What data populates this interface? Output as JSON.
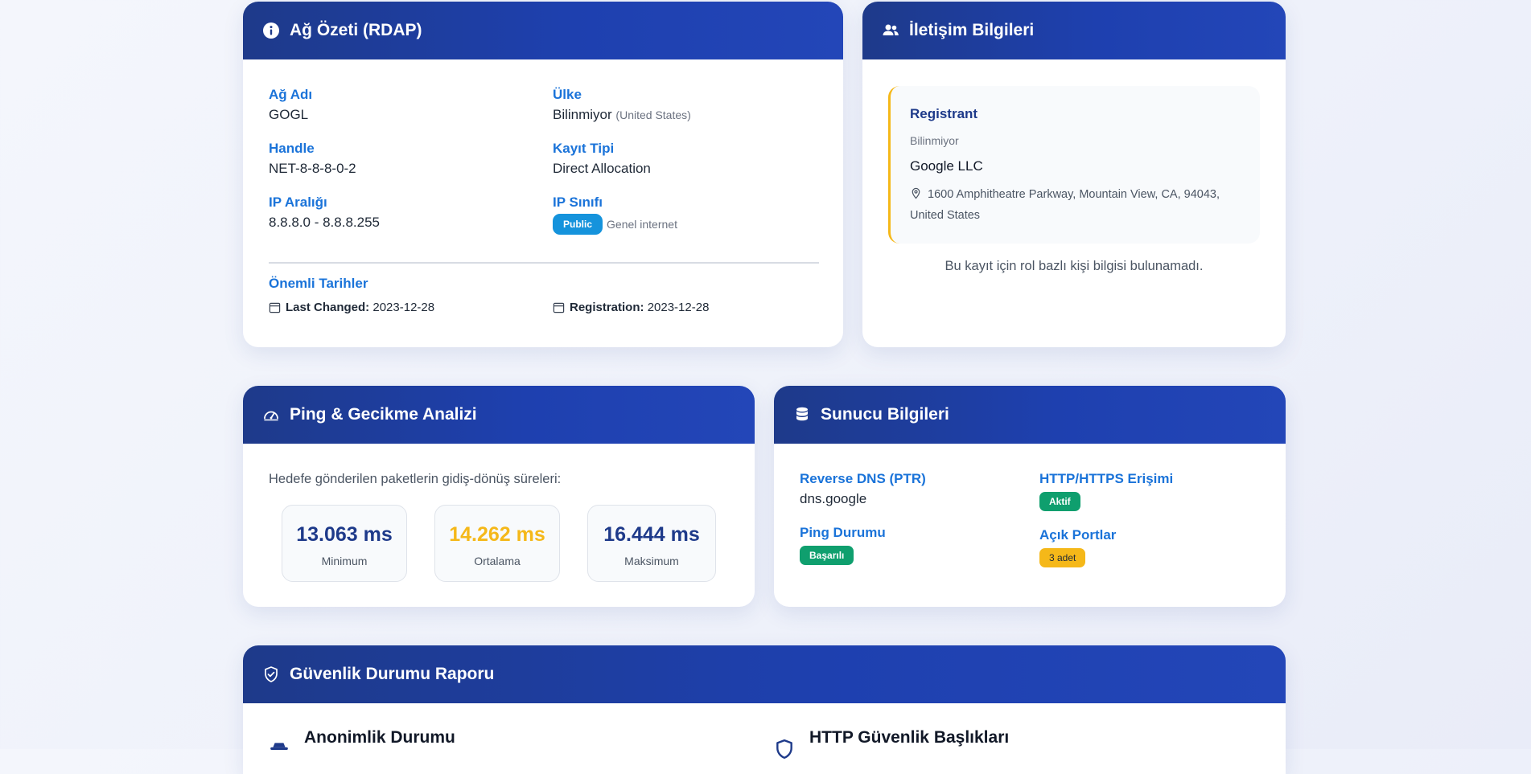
{
  "network_summary": {
    "title": "Ağ Özeti (RDAP)",
    "fields": {
      "network_name": {
        "label": "Ağ Adı",
        "value": "GOGL"
      },
      "country": {
        "label": "Ülke",
        "value": "Bilinmiyor",
        "note": "(United States)"
      },
      "handle": {
        "label": "Handle",
        "value": "NET-8-8-8-0-2"
      },
      "registration_type": {
        "label": "Kayıt Tipi",
        "value": "Direct Allocation"
      },
      "ip_range": {
        "label": "IP Aralığı",
        "value": "8.8.8.0 - 8.8.8.255"
      },
      "ip_class": {
        "label": "IP Sınıfı",
        "badge": "Public",
        "note": "Genel internet"
      }
    },
    "dates": {
      "title": "Önemli Tarihler",
      "last_changed_label": "Last Changed:",
      "last_changed_value": "2023-12-28",
      "registration_label": "Registration:",
      "registration_value": "2023-12-28"
    }
  },
  "contact": {
    "title": "İletişim Bilgileri",
    "role": "Registrant",
    "role_status": "Bilinmiyor",
    "org": "Google LLC",
    "address": "1600 Amphitheatre Parkway, Mountain View, CA, 94043, United States",
    "empty_note": "Bu kayıt için rol bazlı kişi bilgisi bulunamadı."
  },
  "ping": {
    "title": "Ping & Gecikme Analizi",
    "description": "Hedefe gönderilen paketlerin gidiş-dönüş süreleri:",
    "stats": [
      {
        "value": "13.063 ms",
        "label": "Minimum",
        "color": "#1e3a8a"
      },
      {
        "value": "14.262 ms",
        "label": "Ortalama",
        "color": "#f5b819"
      },
      {
        "value": "16.444 ms",
        "label": "Maksimum",
        "color": "#1e3a8a"
      }
    ]
  },
  "server": {
    "title": "Sunucu Bilgileri",
    "reverse_dns_label": "Reverse DNS (PTR)",
    "reverse_dns_value": "dns.google",
    "http_label": "HTTP/HTTPS Erişimi",
    "http_badge": "Aktif",
    "ping_label": "Ping Durumu",
    "ping_badge": "Başarılı",
    "ports_label": "Açık Portlar",
    "ports_badge": "3 adet"
  },
  "security": {
    "title": "Güvenlik Durumu Raporu",
    "anonymity_title": "Anonimlik Durumu",
    "headers_title": "HTTP Güvenlik Başlıkları"
  },
  "colors": {
    "accent": "#1a73d9",
    "header_dark": "#1e3a8a",
    "success": "#0f9f6e",
    "warning": "#f5b819",
    "public_badge": "#1593dc"
  }
}
